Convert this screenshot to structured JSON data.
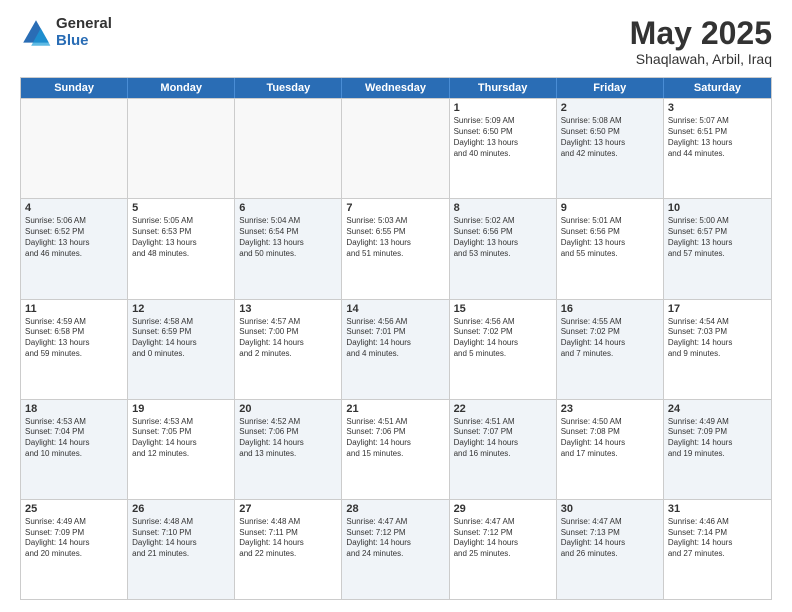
{
  "logo": {
    "general": "General",
    "blue": "Blue"
  },
  "title": "May 2025",
  "location": "Shaqlawah, Arbil, Iraq",
  "weekdays": [
    "Sunday",
    "Monday",
    "Tuesday",
    "Wednesday",
    "Thursday",
    "Friday",
    "Saturday"
  ],
  "rows": [
    [
      {
        "day": "",
        "info": "",
        "empty": true
      },
      {
        "day": "",
        "info": "",
        "empty": true
      },
      {
        "day": "",
        "info": "",
        "empty": true
      },
      {
        "day": "",
        "info": "",
        "empty": true
      },
      {
        "day": "1",
        "info": "Sunrise: 5:09 AM\nSunset: 6:50 PM\nDaylight: 13 hours\nand 40 minutes.",
        "empty": false
      },
      {
        "day": "2",
        "info": "Sunrise: 5:08 AM\nSunset: 6:50 PM\nDaylight: 13 hours\nand 42 minutes.",
        "empty": false,
        "alt": true
      },
      {
        "day": "3",
        "info": "Sunrise: 5:07 AM\nSunset: 6:51 PM\nDaylight: 13 hours\nand 44 minutes.",
        "empty": false
      }
    ],
    [
      {
        "day": "4",
        "info": "Sunrise: 5:06 AM\nSunset: 6:52 PM\nDaylight: 13 hours\nand 46 minutes.",
        "empty": false,
        "alt": true
      },
      {
        "day": "5",
        "info": "Sunrise: 5:05 AM\nSunset: 6:53 PM\nDaylight: 13 hours\nand 48 minutes.",
        "empty": false
      },
      {
        "day": "6",
        "info": "Sunrise: 5:04 AM\nSunset: 6:54 PM\nDaylight: 13 hours\nand 50 minutes.",
        "empty": false,
        "alt": true
      },
      {
        "day": "7",
        "info": "Sunrise: 5:03 AM\nSunset: 6:55 PM\nDaylight: 13 hours\nand 51 minutes.",
        "empty": false
      },
      {
        "day": "8",
        "info": "Sunrise: 5:02 AM\nSunset: 6:56 PM\nDaylight: 13 hours\nand 53 minutes.",
        "empty": false,
        "alt": true
      },
      {
        "day": "9",
        "info": "Sunrise: 5:01 AM\nSunset: 6:56 PM\nDaylight: 13 hours\nand 55 minutes.",
        "empty": false
      },
      {
        "day": "10",
        "info": "Sunrise: 5:00 AM\nSunset: 6:57 PM\nDaylight: 13 hours\nand 57 minutes.",
        "empty": false,
        "alt": true
      }
    ],
    [
      {
        "day": "11",
        "info": "Sunrise: 4:59 AM\nSunset: 6:58 PM\nDaylight: 13 hours\nand 59 minutes.",
        "empty": false
      },
      {
        "day": "12",
        "info": "Sunrise: 4:58 AM\nSunset: 6:59 PM\nDaylight: 14 hours\nand 0 minutes.",
        "empty": false,
        "alt": true
      },
      {
        "day": "13",
        "info": "Sunrise: 4:57 AM\nSunset: 7:00 PM\nDaylight: 14 hours\nand 2 minutes.",
        "empty": false
      },
      {
        "day": "14",
        "info": "Sunrise: 4:56 AM\nSunset: 7:01 PM\nDaylight: 14 hours\nand 4 minutes.",
        "empty": false,
        "alt": true
      },
      {
        "day": "15",
        "info": "Sunrise: 4:56 AM\nSunset: 7:02 PM\nDaylight: 14 hours\nand 5 minutes.",
        "empty": false
      },
      {
        "day": "16",
        "info": "Sunrise: 4:55 AM\nSunset: 7:02 PM\nDaylight: 14 hours\nand 7 minutes.",
        "empty": false,
        "alt": true
      },
      {
        "day": "17",
        "info": "Sunrise: 4:54 AM\nSunset: 7:03 PM\nDaylight: 14 hours\nand 9 minutes.",
        "empty": false
      }
    ],
    [
      {
        "day": "18",
        "info": "Sunrise: 4:53 AM\nSunset: 7:04 PM\nDaylight: 14 hours\nand 10 minutes.",
        "empty": false,
        "alt": true
      },
      {
        "day": "19",
        "info": "Sunrise: 4:53 AM\nSunset: 7:05 PM\nDaylight: 14 hours\nand 12 minutes.",
        "empty": false
      },
      {
        "day": "20",
        "info": "Sunrise: 4:52 AM\nSunset: 7:06 PM\nDaylight: 14 hours\nand 13 minutes.",
        "empty": false,
        "alt": true
      },
      {
        "day": "21",
        "info": "Sunrise: 4:51 AM\nSunset: 7:06 PM\nDaylight: 14 hours\nand 15 minutes.",
        "empty": false
      },
      {
        "day": "22",
        "info": "Sunrise: 4:51 AM\nSunset: 7:07 PM\nDaylight: 14 hours\nand 16 minutes.",
        "empty": false,
        "alt": true
      },
      {
        "day": "23",
        "info": "Sunrise: 4:50 AM\nSunset: 7:08 PM\nDaylight: 14 hours\nand 17 minutes.",
        "empty": false
      },
      {
        "day": "24",
        "info": "Sunrise: 4:49 AM\nSunset: 7:09 PM\nDaylight: 14 hours\nand 19 minutes.",
        "empty": false,
        "alt": true
      }
    ],
    [
      {
        "day": "25",
        "info": "Sunrise: 4:49 AM\nSunset: 7:09 PM\nDaylight: 14 hours\nand 20 minutes.",
        "empty": false
      },
      {
        "day": "26",
        "info": "Sunrise: 4:48 AM\nSunset: 7:10 PM\nDaylight: 14 hours\nand 21 minutes.",
        "empty": false,
        "alt": true
      },
      {
        "day": "27",
        "info": "Sunrise: 4:48 AM\nSunset: 7:11 PM\nDaylight: 14 hours\nand 22 minutes.",
        "empty": false
      },
      {
        "day": "28",
        "info": "Sunrise: 4:47 AM\nSunset: 7:12 PM\nDaylight: 14 hours\nand 24 minutes.",
        "empty": false,
        "alt": true
      },
      {
        "day": "29",
        "info": "Sunrise: 4:47 AM\nSunset: 7:12 PM\nDaylight: 14 hours\nand 25 minutes.",
        "empty": false
      },
      {
        "day": "30",
        "info": "Sunrise: 4:47 AM\nSunset: 7:13 PM\nDaylight: 14 hours\nand 26 minutes.",
        "empty": false,
        "alt": true
      },
      {
        "day": "31",
        "info": "Sunrise: 4:46 AM\nSunset: 7:14 PM\nDaylight: 14 hours\nand 27 minutes.",
        "empty": false
      }
    ]
  ]
}
